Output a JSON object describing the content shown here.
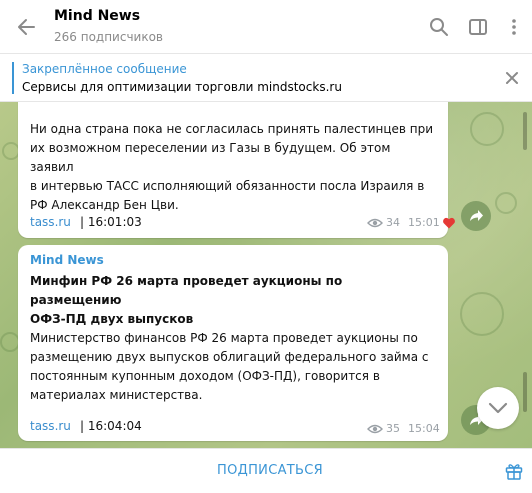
{
  "header": {
    "title": "Mind News",
    "subtitle": "266 подписчиков"
  },
  "pinned": {
    "title": "Закреплённое сообщение",
    "text": "Сервисы для оптимизации торговли mindstocks.ru"
  },
  "messages": [
    {
      "body_lines": [
        "Ни одна страна пока не согласилась принять палестинцев при",
        "их возможном переселении из Газы в будущем. Об этом заявил",
        "в интервью ТАСС исполняющий обязанности посла Израиля в",
        "РФ Александр Бен Цви."
      ],
      "source": "tass.ru",
      "source_time": "| 16:01:03",
      "views": "34",
      "time": "15:01",
      "reaction": "heart"
    },
    {
      "author": "Mind News",
      "headline_lines": [
        "Минфин РФ 26 марта проведет аукционы по размещению",
        "ОФЗ-ПД двух выпусков"
      ],
      "body_lines": [
        "Министерство финансов РФ 26 марта проведет аукционы по",
        "размещению двух выпусков облигаций федерального займа с",
        "постоянным купонным доходом (ОФЗ-ПД), говорится в",
        "материалах министерства."
      ],
      "source": "tass.ru",
      "source_time": "| 16:04:04",
      "views": "35",
      "time": "15:04"
    }
  ],
  "bottom": {
    "subscribe_label": "ПОДПИСАТЬСЯ"
  },
  "colors": {
    "accent": "#3a95d5",
    "link": "#3a8dce",
    "chat_bg": "#a8c07f",
    "reaction_heart": "#e53935"
  },
  "icons": [
    "back-arrow-icon",
    "search-icon",
    "sidebar-toggle-icon",
    "more-vertical-icon",
    "close-icon",
    "eye-icon",
    "heart-icon",
    "share-icon",
    "chevron-down-icon",
    "gift-icon"
  ]
}
